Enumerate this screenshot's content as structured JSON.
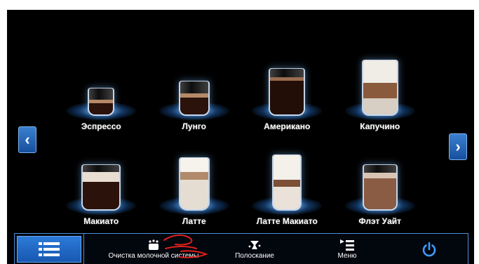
{
  "drinks": [
    {
      "label": "Эспрессо",
      "fill": "espresso"
    },
    {
      "label": "Лунго",
      "fill": "lungo"
    },
    {
      "label": "Американо",
      "fill": "americano"
    },
    {
      "label": "Капучино",
      "fill": "cappuccino"
    },
    {
      "label": "Макиато",
      "fill": "macchiato"
    },
    {
      "label": "Латте",
      "fill": "latte"
    },
    {
      "label": "Латте Макиато",
      "fill": "latte-macchiato"
    },
    {
      "label": "Флэт Уайт",
      "fill": "flat-white"
    }
  ],
  "nav": {
    "prev_icon": "chevron-left-icon",
    "next_icon": "chevron-right-icon",
    "prev_glyph": "‹",
    "next_glyph": "›"
  },
  "bottom_bar": {
    "milk_clean_label": "Очистка молочной системы",
    "rinse_label": "Полоскание",
    "menu_label": "Меню"
  },
  "colors": {
    "accent": "#2c7ad8",
    "border": "#4d8fd8",
    "background": "#000000",
    "annotation": "#e0201c"
  }
}
